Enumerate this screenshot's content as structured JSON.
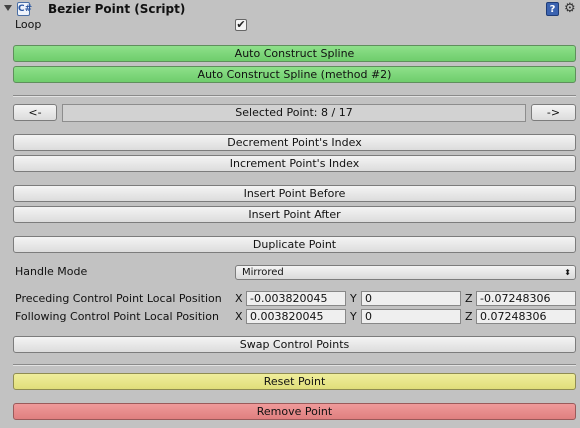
{
  "header": {
    "title": "Bezier Point (Script)",
    "script_icon_glyph": "C#",
    "help_icon_glyph": "?",
    "gear_icon_glyph": "⚙"
  },
  "loop": {
    "label": "Loop",
    "checked": true,
    "check_glyph": "✔"
  },
  "buttons": {
    "auto_construct": "Auto Construct Spline",
    "auto_construct_2": "Auto Construct Spline (method #2)",
    "prev": "<-",
    "next": "->",
    "selected_point": "Selected Point: 8 / 17",
    "decrement": "Decrement Point's Index",
    "increment": "Increment Point's Index",
    "insert_before": "Insert Point Before",
    "insert_after": "Insert Point After",
    "duplicate": "Duplicate Point",
    "swap": "Swap Control Points",
    "reset": "Reset Point",
    "remove": "Remove Point"
  },
  "handle_mode": {
    "label": "Handle Mode",
    "value": "Mirrored",
    "arrow_glyph": "⬍"
  },
  "preceding": {
    "label": "Preceding Control Point Local Position",
    "x_label": "X",
    "y_label": "Y",
    "z_label": "Z",
    "x": "-0.003820045",
    "y": "0",
    "z": "-0.07248306"
  },
  "following": {
    "label": "Following Control Point Local Position",
    "x_label": "X",
    "y_label": "Y",
    "z_label": "Z",
    "x": "0.003820045",
    "y": "0",
    "z": "0.07248306"
  },
  "colors": {
    "background": "#c2c2c2",
    "green_button": "#7fd67c",
    "yellow_button": "#e8e68a",
    "red_button": "#e88c8c"
  }
}
